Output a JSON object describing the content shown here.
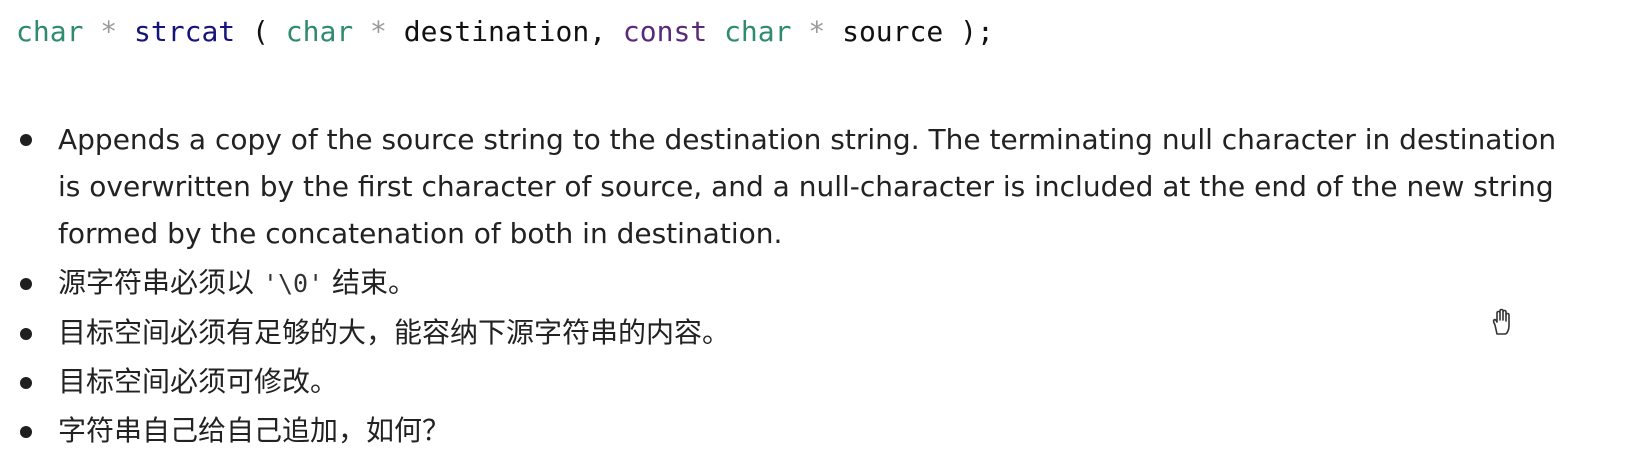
{
  "code": {
    "return_type": "char",
    "star1": "*",
    "function_name": "strcat",
    "open_paren": "(",
    "param1_type": "char",
    "star2": "*",
    "param1_name": "destination,",
    "param2_qualifier": "const",
    "param2_type": "char",
    "star3": "*",
    "param2_name": "source",
    "close": ");"
  },
  "bullets": [
    {
      "text": "Appends a copy of the source string to the destination string. The terminating null character in destination is overwritten by the first character of source, and a null-character is included at the end of the new string formed by the concatenation of both in destination."
    },
    {
      "before": "源字符串必须以",
      "code": "'\\0'",
      "after": "结束。"
    },
    {
      "text": "目标空间必须有足够的大，能容纳下源字符串的内容。"
    },
    {
      "text": "目标空间必须可修改。"
    },
    {
      "text": "字符串自己给自己追加，如何？"
    }
  ],
  "colors": {
    "type": "#2e8b6f",
    "function": "#15157a",
    "keyword": "#5a2a7a",
    "pointer_star": "#9a9a9a",
    "body_text": "#222222"
  },
  "icons": {
    "cursor": "hand-cursor-icon"
  }
}
